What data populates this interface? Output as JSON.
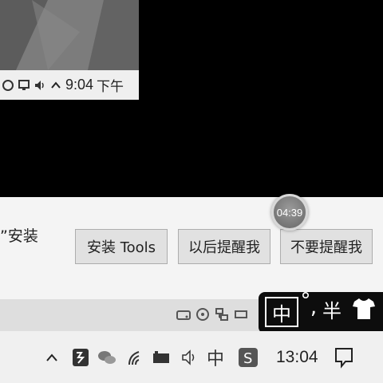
{
  "vm_preview": {
    "time": "9:04",
    "ampm": "下午"
  },
  "notification": {
    "text_fragment": "”安装",
    "install_button": "安装 Tools",
    "remind_later_button": "以后提醒我",
    "never_remind_button": "不要提醒我"
  },
  "timer": {
    "value": "04:39"
  },
  "ime": {
    "mode": "中",
    "degree": "°",
    "punctuation": ",",
    "width_mode": "半"
  },
  "taskbar": {
    "ime_indicator": "中",
    "clock": "13:04"
  },
  "icons": {
    "vm_tray": [
      "network-icon",
      "monitor-icon",
      "volume-icon",
      "chevron-up-icon"
    ],
    "status_strip": [
      "hdd-icon",
      "cd-icon",
      "network-adapter-icon",
      "usb-icon"
    ],
    "host_tray": [
      "chevron-up-icon",
      "app-icon",
      "wechat-icon",
      "wifi-icon",
      "battery-icon",
      "volume-icon",
      "sogou-icon",
      "notification-icon"
    ]
  }
}
